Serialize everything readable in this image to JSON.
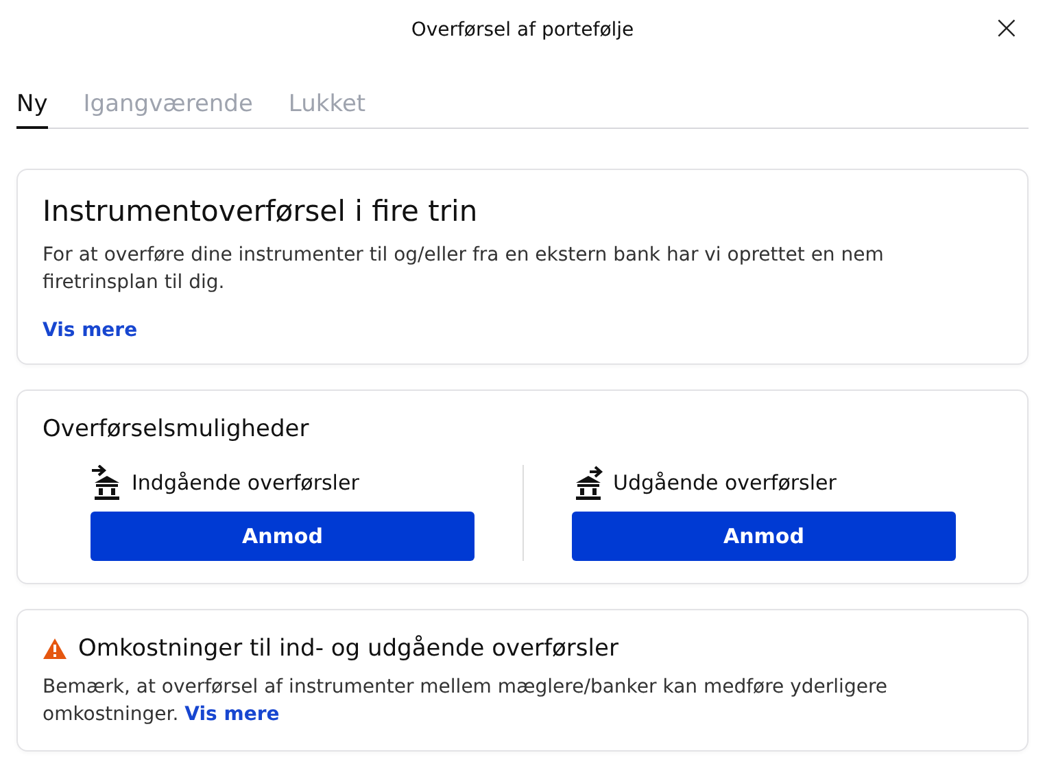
{
  "dialog": {
    "title": "Overførsel af portefølje",
    "close": "×"
  },
  "tabs": [
    {
      "label": "Ny",
      "selected": true
    },
    {
      "label": "Igangværende",
      "selected": false
    },
    {
      "label": "Lukket",
      "selected": false
    }
  ],
  "intro": {
    "title": "Instrumentoverførsel i fire trin",
    "text": "For at overføre dine instrumenter til og/eller fra en ekstern bank har vi oprettet en nem firetrinsplan til dig.",
    "link": "Vis mere"
  },
  "options": {
    "title": "Overførselsmuligheder",
    "items": [
      {
        "kind": "incoming",
        "label": "Indgående overførsler",
        "button": "Anmod"
      },
      {
        "kind": "outgoing",
        "label": "Udgående overførsler",
        "button": "Anmod"
      }
    ]
  },
  "costs": {
    "title": "Omkostninger til ind- og udgående overførsler",
    "text": "Bemærk, at overførsel af instrumenter mellem mæglere/banker kan medføre yderligere omkostninger.",
    "link": "Vis mere"
  }
}
